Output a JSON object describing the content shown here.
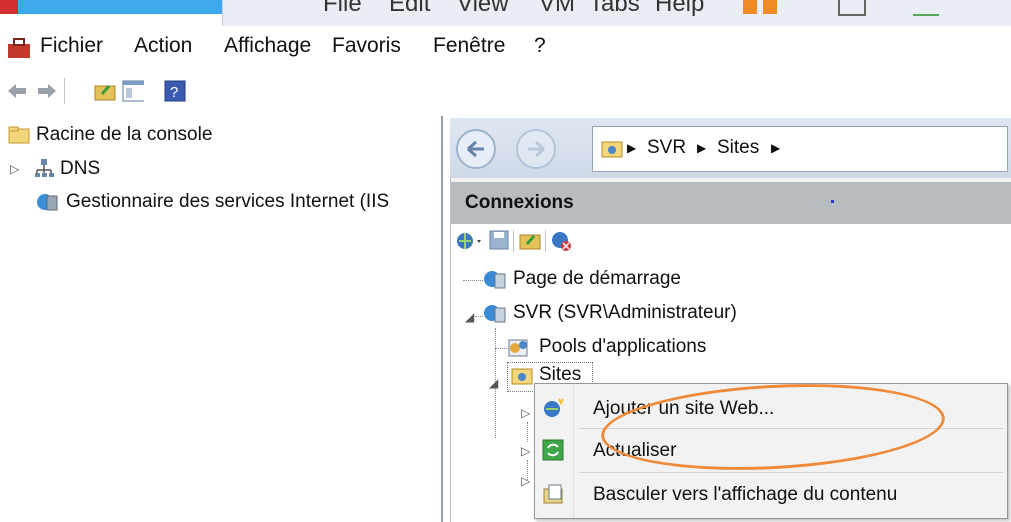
{
  "vm_bar": {
    "menu": [
      "File",
      "Edit",
      "View",
      "VM",
      "Tabs",
      "Help"
    ]
  },
  "menubar": {
    "items": [
      "Fichier",
      "Action",
      "Affichage",
      "Favoris",
      "Fenêtre",
      "?"
    ]
  },
  "left_tree": {
    "root": "Racine de la console",
    "items": [
      "DNS",
      "Gestionnaire des services Internet (IIS"
    ]
  },
  "address": {
    "parts": [
      "SVR",
      "Sites"
    ]
  },
  "connections": {
    "header": "Connexions",
    "tree": {
      "start_page": "Page de démarrage",
      "server": "SVR (SVR\\Administrateur)",
      "app_pools": "Pools d'applications",
      "sites": "Sites"
    }
  },
  "context_menu": {
    "items": [
      "Ajouter un site Web...",
      "Actualiser",
      "Basculer vers l'affichage du contenu"
    ]
  },
  "colors": {
    "annotation_oval": "#ef8a3a",
    "header_bg": "#b7bcc1"
  }
}
